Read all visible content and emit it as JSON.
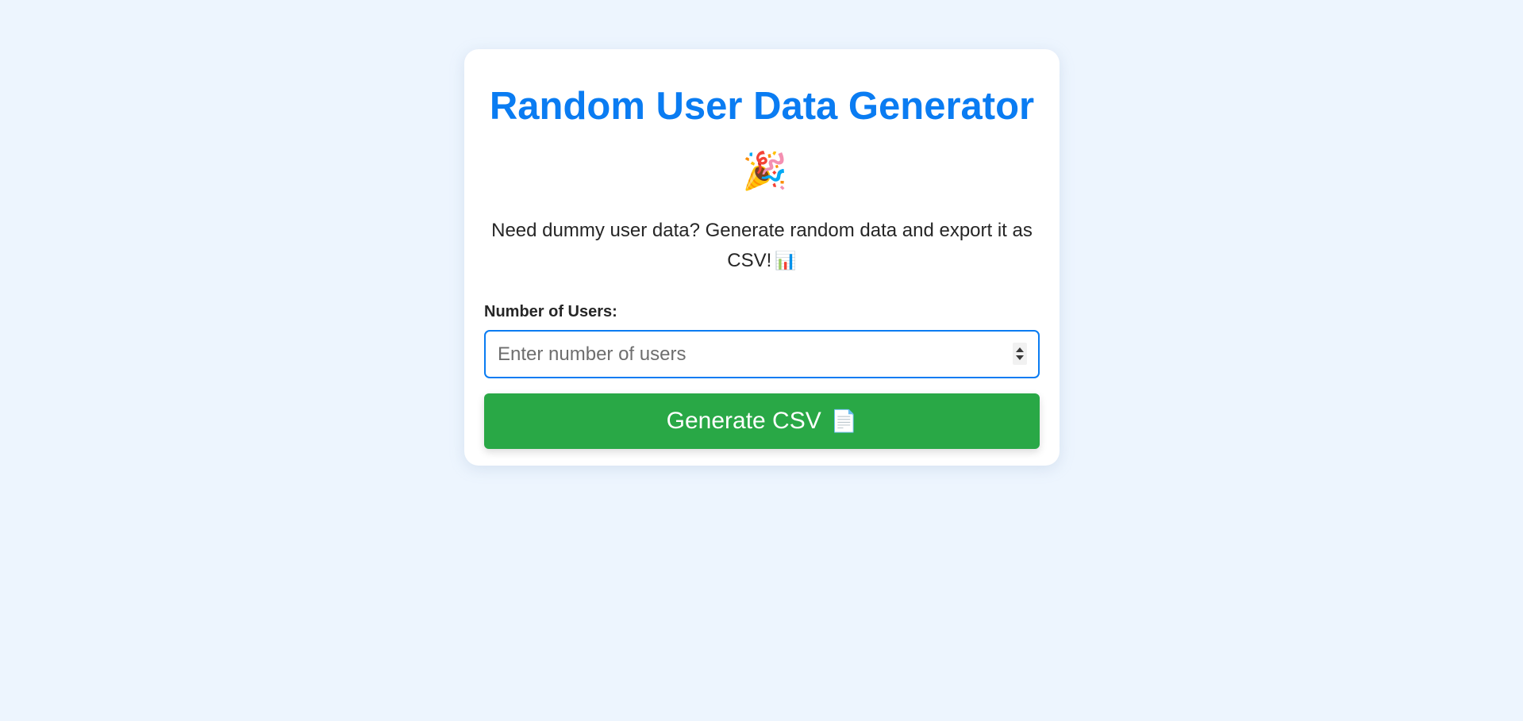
{
  "header": {
    "title": "Random User Data Generator",
    "title_emoji": "🎉"
  },
  "description": {
    "text": "Need dummy user data? Generate random data and export it as CSV!",
    "emoji": "📊"
  },
  "form": {
    "label": "Number of Users:",
    "input_value": "",
    "input_placeholder": "Enter number of users"
  },
  "button": {
    "label": "Generate CSV",
    "emoji": "📄"
  },
  "colors": {
    "background": "#edf5fe",
    "card": "#ffffff",
    "title": "#0a7cf2",
    "input_border": "#0a7cf2",
    "button": "#29a846",
    "button_text": "#ffffff",
    "text": "#262626"
  },
  "icons": {
    "title": "party-popper-icon",
    "description": "bar-chart-icon",
    "button": "document-icon",
    "input_stepper": "spin-arrows-icon"
  }
}
